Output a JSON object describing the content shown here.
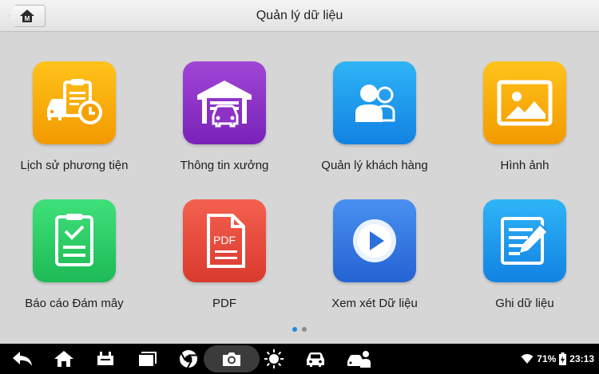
{
  "header": {
    "home_icon": "home-m-icon",
    "home_letter": "M",
    "title": "Quản lý dữ liệu"
  },
  "tiles": [
    {
      "label": "Lịch sử phương tiện",
      "icon": "vehicle-history-icon",
      "color_top": "#ffc21a",
      "color_bottom": "#f29a00"
    },
    {
      "label": "Thông tin xưởng",
      "icon": "workshop-icon",
      "color_top": "#a046d6",
      "color_bottom": "#7a22b8"
    },
    {
      "label": "Quản lý khách hàng",
      "icon": "customers-icon",
      "color_top": "#2fb4f6",
      "color_bottom": "#1282e3"
    },
    {
      "label": "Hình ảnh",
      "icon": "image-icon",
      "color_top": "#ffc21a",
      "color_bottom": "#f29a00"
    },
    {
      "label": "Báo cáo Đám mây",
      "icon": "cloud-report-icon",
      "color_top": "#3fe07a",
      "color_bottom": "#1dba55"
    },
    {
      "label": "PDF",
      "icon": "pdf-icon",
      "color_top": "#f4604f",
      "color_bottom": "#d93a2d"
    },
    {
      "label": "Xem xét Dữ liệu",
      "icon": "data-review-icon",
      "color_top": "#4a90f0",
      "color_bottom": "#2463d3"
    },
    {
      "label": "Ghi dữ liệu",
      "icon": "data-record-icon",
      "color_top": "#2fb4f6",
      "color_bottom": "#1282e3"
    }
  ],
  "pagination": {
    "pages": 2,
    "active": 1,
    "active_color": "#1e88e5",
    "inactive_color": "#8a8a8a"
  },
  "navbar": {
    "buttons": [
      "back-icon",
      "home-icon",
      "vci-icon",
      "recent-apps-icon",
      "browser-icon",
      "camera-icon",
      "brightness-icon",
      "vehicle-icon",
      "remote-support-icon"
    ]
  },
  "status": {
    "wifi_icon": "wifi-icon",
    "battery_text": "71%",
    "battery_icon": "battery-charging-icon",
    "time": "23:13"
  }
}
